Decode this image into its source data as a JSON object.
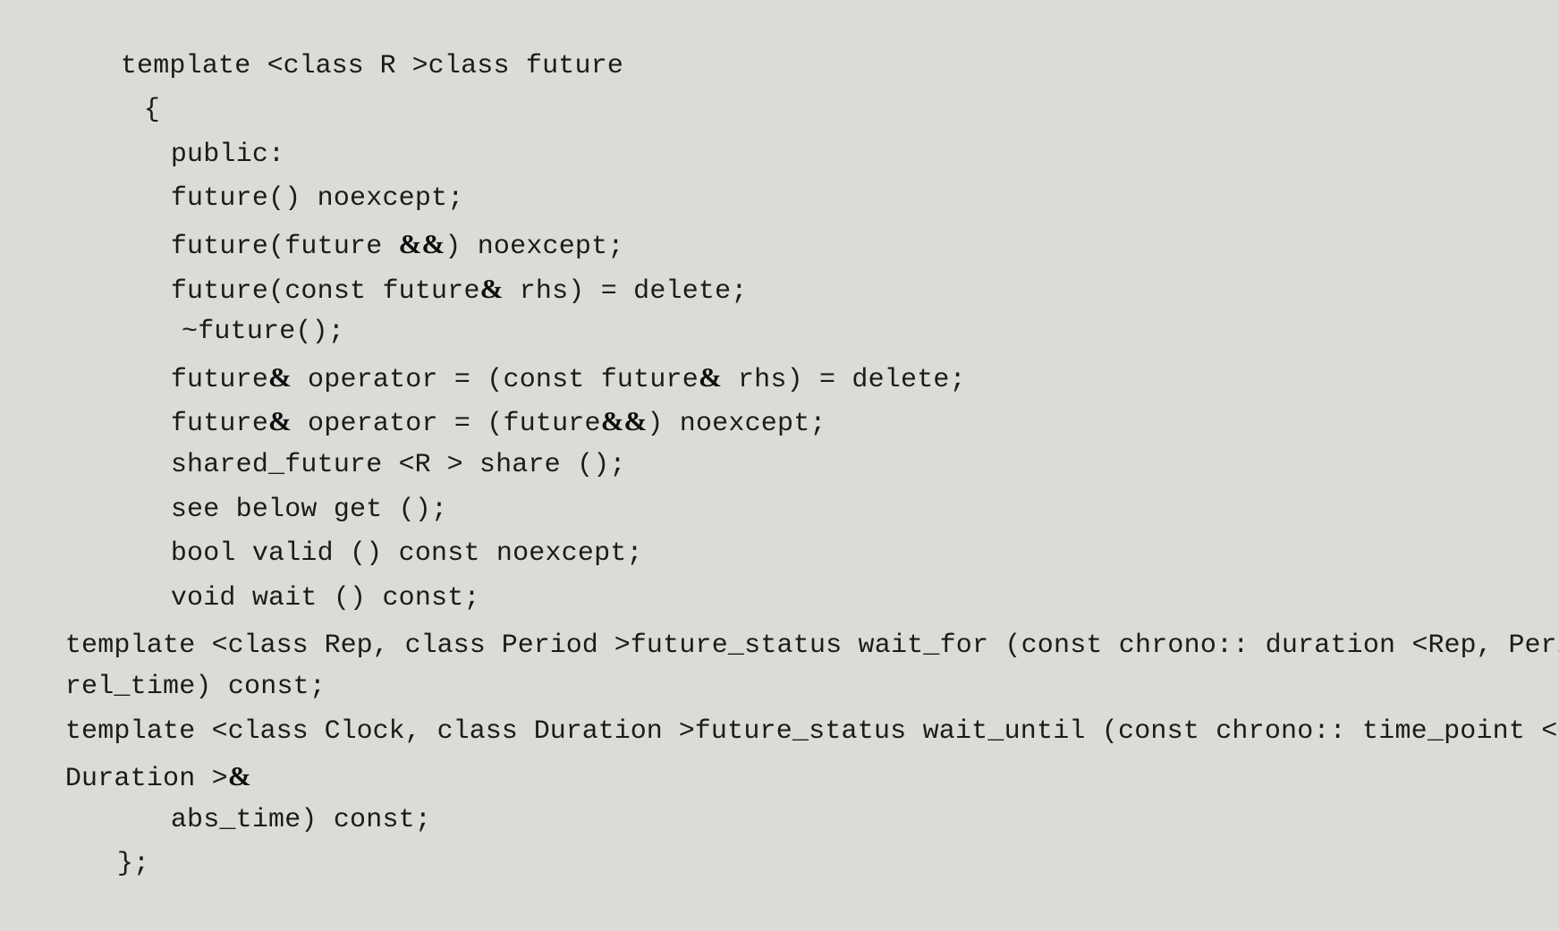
{
  "document": {
    "kind": "code-listing",
    "language": "C++",
    "background_color": "#dcdbd7",
    "text_color": "#1b1b1b",
    "bold_token_color": "#0d0d0d",
    "title": "template <class R> class future"
  },
  "code": {
    "lines": [
      {
        "id": "line-1",
        "indent": 1,
        "text": "template <class R >class future"
      },
      {
        "id": "line-2",
        "indent": 2,
        "text": "{"
      },
      {
        "id": "line-3",
        "indent": 3,
        "text": "public:"
      },
      {
        "id": "line-4",
        "indent": 3,
        "text": "future() noexcept;"
      },
      {
        "id": "line-5",
        "indent": 3,
        "text": "future(future &&) noexcept;",
        "bold_tokens": [
          "&&"
        ]
      },
      {
        "id": "line-6",
        "indent": 3,
        "text": "future(const future& rhs) = delete;",
        "bold_tokens": [
          "&"
        ]
      },
      {
        "id": "line-7",
        "indent": 4,
        "text": " ~future();"
      },
      {
        "id": "line-8",
        "indent": 3,
        "text": "future& operator = (const future& rhs) = delete;",
        "bold_tokens": [
          "&",
          "&"
        ]
      },
      {
        "id": "line-9",
        "indent": 3,
        "text": "future& operator = (future&&) noexcept;",
        "bold_tokens": [
          "&",
          "&&"
        ]
      },
      {
        "id": "line-10",
        "indent": 3,
        "text": "shared_future <R > share ();"
      },
      {
        "id": "line-11",
        "indent": 3,
        "text": "see below get ();"
      },
      {
        "id": "line-12",
        "indent": 3,
        "text": "bool valid () const noexcept;"
      },
      {
        "id": "line-13",
        "indent": 3,
        "text": "void wait () const;"
      },
      {
        "id": "line-14",
        "indent": 0,
        "text": "template <class Rep, class Period > future_status wait_for (const chrono:: duration <Rep, Period >&",
        "bold_tokens": [
          "&"
        ]
      },
      {
        "id": "line-15",
        "indent": 0,
        "text": "rel_time) const;"
      },
      {
        "id": "line-16",
        "indent": 0,
        "text": "template <class Clock, class Duration > future_status wait_until (const chrono:: time_point <Clock,"
      },
      {
        "id": "line-17",
        "indent": 0,
        "text": "Duration >&",
        "bold_tokens": [
          "&"
        ]
      },
      {
        "id": "line-18",
        "indent": 3,
        "text": "abs_time) const;"
      },
      {
        "id": "line-19",
        "indent": 5,
        "text": "};"
      }
    ]
  }
}
